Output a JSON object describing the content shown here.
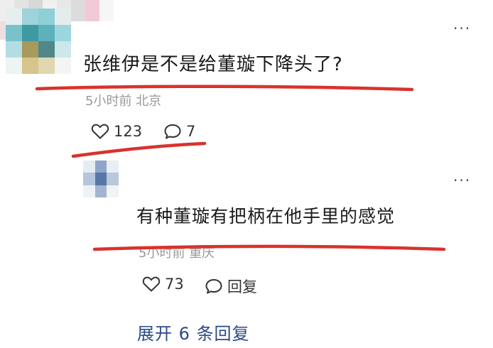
{
  "comments": [
    {
      "text": "张维伊是不是给董璇下降头了?",
      "meta": "5小时前 北京",
      "likes": "123",
      "replies": "7"
    },
    {
      "text": "有种董璇有把柄在他手里的感觉",
      "meta": "5小时前 重庆",
      "likes": "73",
      "reply_label": "回复"
    }
  ],
  "more_label": "···",
  "expand_label": "展开 6 条回复",
  "colors": {
    "annotation_red": "#d9322d",
    "link_blue": "#2a4a8a"
  },
  "icons": [
    "heart-icon",
    "comment-bubble-icon",
    "more-icon"
  ]
}
